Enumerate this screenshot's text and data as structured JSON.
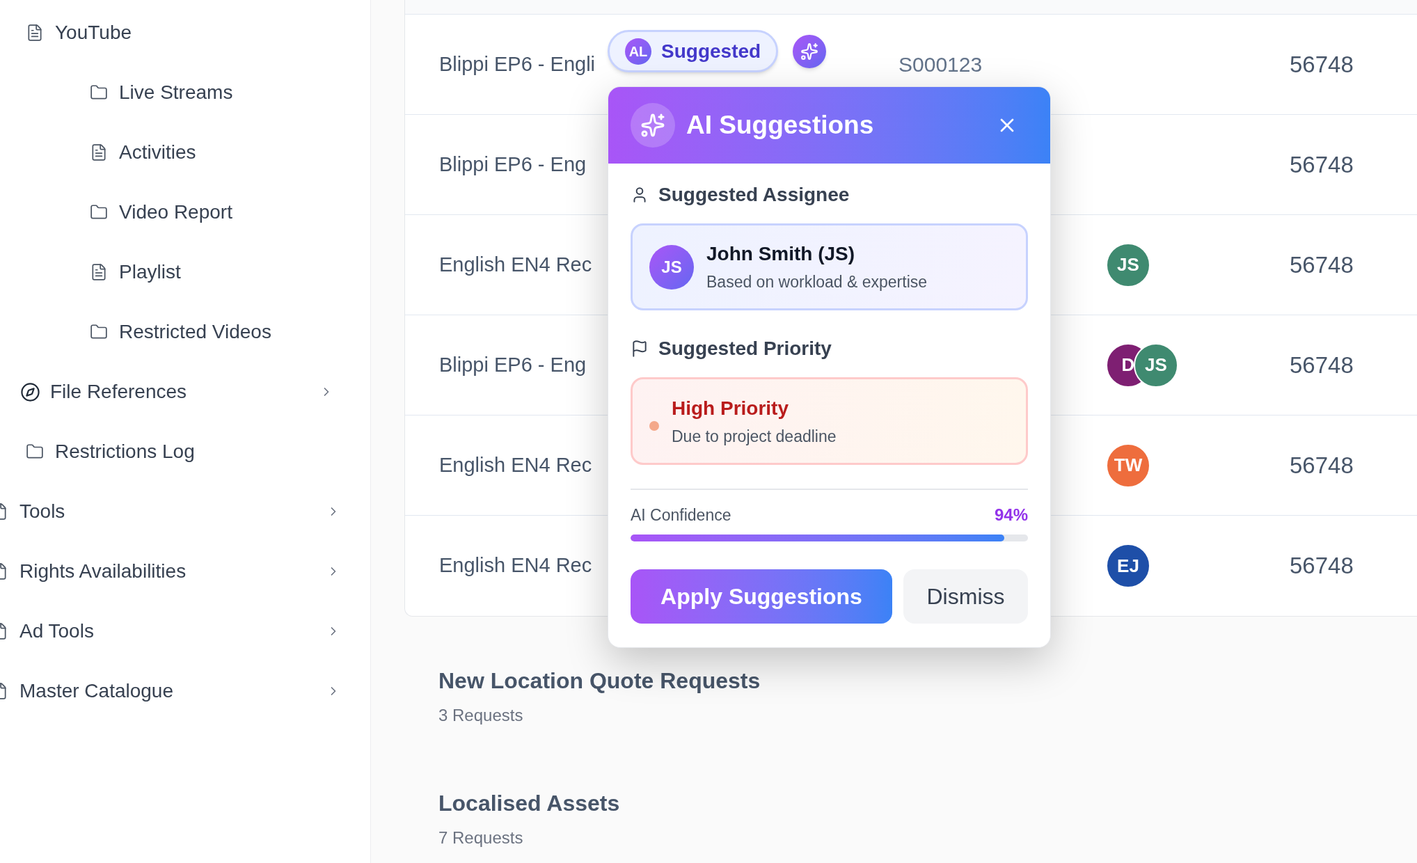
{
  "sidebar": {
    "nested_items": [
      {
        "label": "YouTube",
        "kind": "document",
        "expanded": true,
        "children": [
          {
            "label": "Live Streams",
            "kind": "folder"
          },
          {
            "label": "Activities",
            "kind": "document"
          },
          {
            "label": "Video Report",
            "kind": "folder"
          },
          {
            "label": "Playlist",
            "kind": "document"
          },
          {
            "label": "Restricted Videos",
            "kind": "folder"
          }
        ]
      },
      {
        "label": "File References",
        "kind": "compass",
        "expanded": false
      },
      {
        "label": "Restrictions Log",
        "kind": "folder"
      }
    ],
    "items": [
      {
        "label": "Tools",
        "kind": "file",
        "expanded": false
      },
      {
        "label": "Rights Availabilities",
        "kind": "file",
        "expanded": false
      },
      {
        "label": "Ad Tools",
        "kind": "file",
        "expanded": false
      },
      {
        "label": "Master Catalogue",
        "kind": "file",
        "expanded": false
      }
    ]
  },
  "table": {
    "rows": [
      {
        "title": "Blippi EP6 - Engli",
        "code": "S000123",
        "assignees": [],
        "count": "56748"
      },
      {
        "title": "Blippi EP6 - Eng",
        "assignees": [],
        "count": "56748"
      },
      {
        "title": "English EN4 Rec",
        "assignees": [
          {
            "initials": "JS",
            "color": "#3f8a70"
          }
        ],
        "count": "56748"
      },
      {
        "title": "Blippi EP6 - Eng",
        "assignees": [
          {
            "initials": "D",
            "color": "#7e1f72"
          },
          {
            "initials": "JS",
            "color": "#3f8a70"
          }
        ],
        "count": "56748"
      },
      {
        "title": "English EN4 Rec",
        "assignees": [
          {
            "initials": "TW",
            "color": "#ee6d3d"
          }
        ],
        "count": "56748"
      },
      {
        "title": "English EN4 Rec",
        "assignees": [
          {
            "initials": "EJ",
            "color": "#1e4fa8"
          }
        ],
        "count": "56748"
      }
    ]
  },
  "suggestion_chip": {
    "avatar": "AL",
    "label": "Suggested"
  },
  "ai_popup": {
    "title": "AI Suggestions",
    "assignee": {
      "heading": "Suggested Assignee",
      "avatar": "JS",
      "name": "John Smith (JS)",
      "reason": "Based on workload & expertise"
    },
    "priority": {
      "heading": "Suggested Priority",
      "label": "High Priority",
      "reason": "Due to project deadline"
    },
    "confidence": {
      "label": "AI Confidence",
      "reading": "94%",
      "level": 0.94
    },
    "buttons": [
      {
        "label": "Apply Suggestions",
        "kind": "primary"
      },
      {
        "label": "Dismiss",
        "kind": "secondary"
      }
    ]
  },
  "sections": [
    {
      "title": "New Location Quote Requests",
      "count": "3 Requests"
    },
    {
      "title": "Localised Assets",
      "count": "7 Requests"
    }
  ]
}
